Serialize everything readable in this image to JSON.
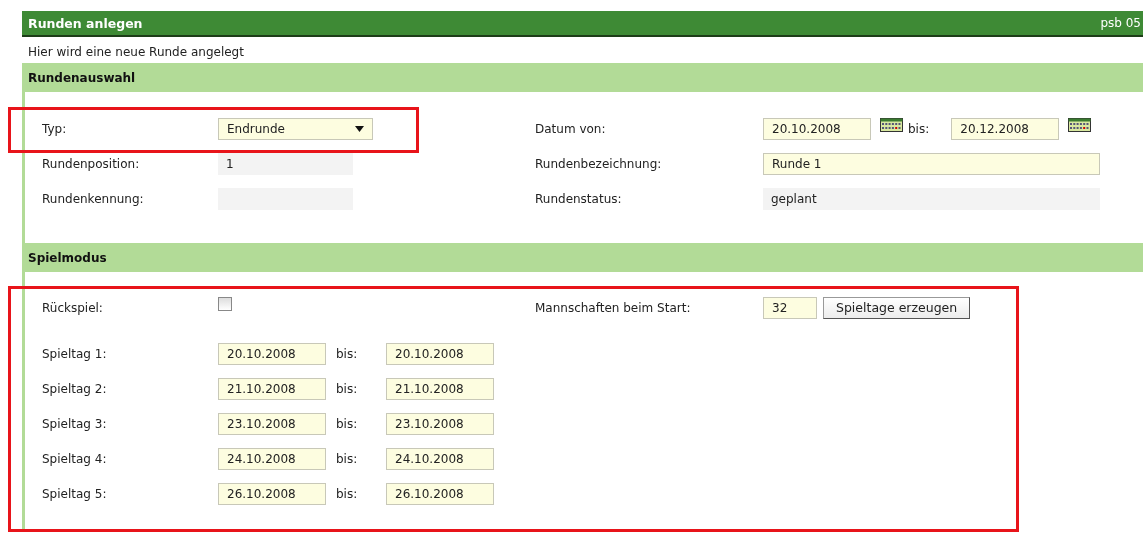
{
  "header": {
    "title": "Runden anlegen",
    "code": "psb 05"
  },
  "intro": "Hier wird eine neue Runde angelegt",
  "rundenauswahl": {
    "title": "Rundenauswahl",
    "typ": {
      "label": "Typ:",
      "value": "Endrunde"
    },
    "position": {
      "label": "Rundenposition:",
      "value": "1"
    },
    "kennung": {
      "label": "Rundenkennung:"
    },
    "datum": {
      "label": "Datum von:",
      "from": "20.10.2008",
      "separator": "bis:",
      "to": "20.12.2008"
    },
    "bezeichnung": {
      "label": "Rundenbezeichnung:",
      "value": "Runde 1"
    },
    "status": {
      "label": "Rundenstatus:",
      "value": "geplant"
    }
  },
  "spielmodus": {
    "title": "Spielmodus",
    "rueckspiel": {
      "label": "Rückspiel:",
      "checked": false
    },
    "mannschaften": {
      "label": "Mannschaften beim Start:",
      "value": "32",
      "button": "Spieltage erzeugen"
    },
    "spieltage": [
      {
        "label": "Spieltag 1:",
        "from": "20.10.2008",
        "separator": "bis:",
        "to": "20.10.2008"
      },
      {
        "label": "Spieltag 2:",
        "from": "21.10.2008",
        "separator": "bis:",
        "to": "21.10.2008"
      },
      {
        "label": "Spieltag 3:",
        "from": "23.10.2008",
        "separator": "bis:",
        "to": "23.10.2008"
      },
      {
        "label": "Spieltag 4:",
        "from": "24.10.2008",
        "separator": "bis:",
        "to": "24.10.2008"
      },
      {
        "label": "Spieltag 5:",
        "from": "26.10.2008",
        "separator": "bis:",
        "to": "26.10.2008"
      }
    ]
  }
}
